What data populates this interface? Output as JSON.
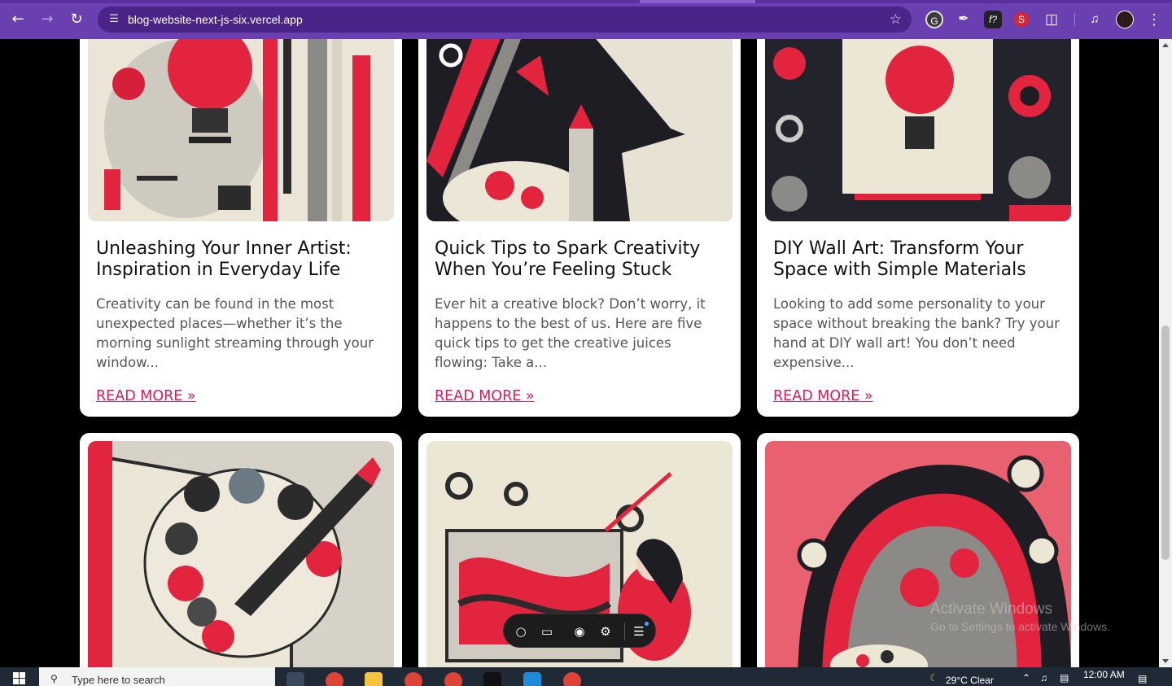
{
  "browser": {
    "url": "blog-website-next-js-six.vercel.app",
    "extensions": [
      "grammarly-icon",
      "eyedropper-icon",
      "font-icon",
      "red-extension-icon",
      "puzzle-icon"
    ]
  },
  "posts": [
    {
      "title": "Unleashing Your Inner Artist: Inspiration in Everyday Life",
      "excerpt": "Creativity can be found in the most unexpected places—whether it’s the morning sunlight streaming through your window...",
      "read_more": "READ MORE »"
    },
    {
      "title": "Quick Tips to Spark Creativity When You’re Feeling Stuck",
      "excerpt": "Ever hit a creative block? Don’t worry, it happens to the best of us. Here are five quick tips to get the creative juices flowing: Take a...",
      "read_more": "READ MORE »"
    },
    {
      "title": "DIY Wall Art: Transform Your Space with Simple Materials",
      "excerpt": "Looking to add some personality to your space without breaking the bank? Try your hand at DIY wall art! You don’t need expensive...",
      "read_more": "READ MORE »"
    }
  ],
  "watermark": {
    "title": "Activate Windows",
    "subtitle": "Go to Settings to activate Windows."
  },
  "taskbar": {
    "search_placeholder": "Type here to search",
    "weather": "29°C  Clear",
    "time": "12:00 AM"
  },
  "colors": {
    "browser_frame": "#6a3fb0",
    "accent": "#e0185a",
    "page_bg": "#000000"
  }
}
